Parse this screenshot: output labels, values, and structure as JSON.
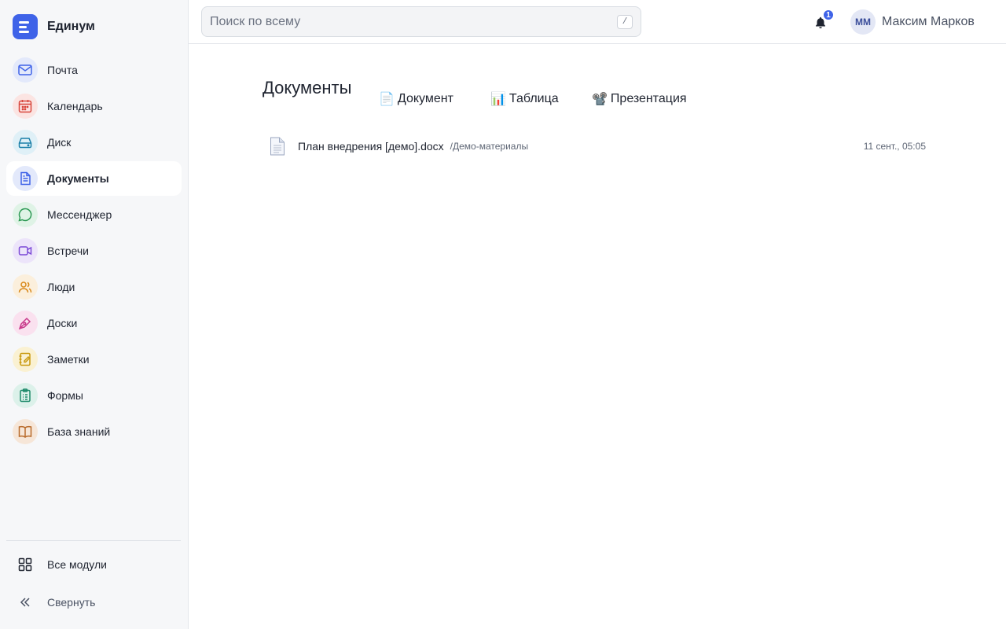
{
  "app": {
    "name": "Единум"
  },
  "sidebar": {
    "items": [
      {
        "id": "mail",
        "label": "Почта",
        "icon": "mail-icon",
        "color": "#3f63e8",
        "bg": "#e3e9fb"
      },
      {
        "id": "calendar",
        "label": "Календарь",
        "icon": "calendar-icon",
        "color": "#d8453b",
        "bg": "#fbe4e2"
      },
      {
        "id": "disk",
        "label": "Диск",
        "icon": "drive-icon",
        "color": "#1a7fa8",
        "bg": "#dff0f7"
      },
      {
        "id": "documents",
        "label": "Документы",
        "icon": "document-icon",
        "color": "#3f63e8",
        "bg": "#e3e9fb",
        "active": true
      },
      {
        "id": "messenger",
        "label": "Мессенджер",
        "icon": "chat-icon",
        "color": "#2e9a55",
        "bg": "#dff3e6"
      },
      {
        "id": "meetings",
        "label": "Встречи",
        "icon": "video-icon",
        "color": "#7a48d6",
        "bg": "#ece4fa"
      },
      {
        "id": "people",
        "label": "Люди",
        "icon": "people-icon",
        "color": "#d98a1c",
        "bg": "#fbefdc"
      },
      {
        "id": "boards",
        "label": "Доски",
        "icon": "pen-icon",
        "color": "#c8378a",
        "bg": "#fae1ef"
      },
      {
        "id": "notes",
        "label": "Заметки",
        "icon": "note-icon",
        "color": "#c99a10",
        "bg": "#faf1d2"
      },
      {
        "id": "forms",
        "label": "Формы",
        "icon": "clipboard-icon",
        "color": "#1e8a6a",
        "bg": "#dcf1ea"
      },
      {
        "id": "kb",
        "label": "База знаний",
        "icon": "book-icon",
        "color": "#b86a2a",
        "bg": "#f6e6d8"
      }
    ],
    "all_modules_label": "Все модули",
    "collapse_label": "Свернуть"
  },
  "topbar": {
    "search_placeholder": "Поиск по всему",
    "search_shortcut": "/",
    "notifications_count": "1",
    "user_initials": "ММ",
    "user_name": "Максим Марков"
  },
  "main": {
    "title": "Документы",
    "create_buttons": [
      {
        "emoji": "📄",
        "label": "Документ"
      },
      {
        "emoji": "📊",
        "label": "Таблица"
      },
      {
        "emoji": "📽️",
        "label": "Презентация"
      }
    ],
    "files": [
      {
        "name": "План внедрения [демо].docx",
        "path": "/Демо-материалы",
        "date": "11 сент., 05:05"
      }
    ]
  }
}
